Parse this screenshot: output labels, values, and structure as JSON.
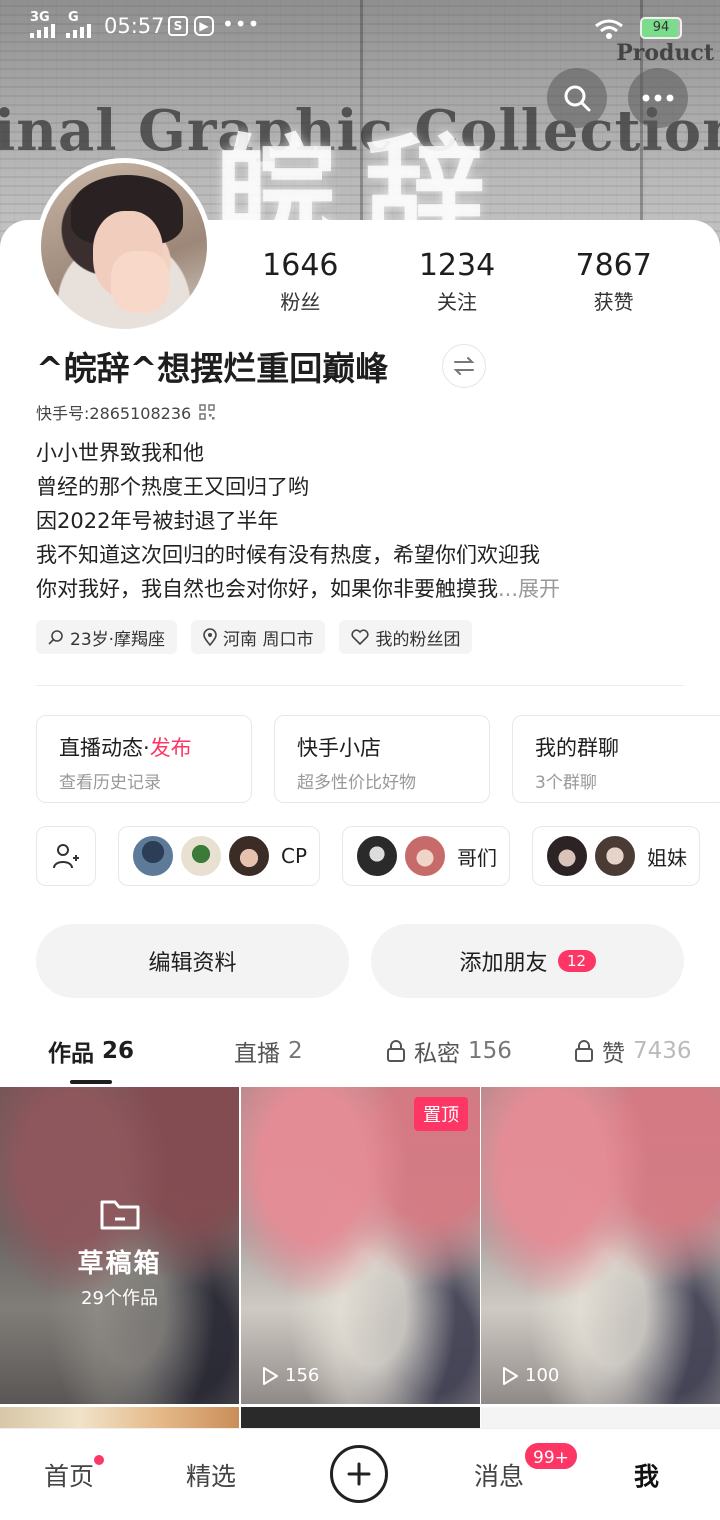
{
  "status_bar": {
    "network_1": "3G",
    "network_2": "G",
    "time": "05:57",
    "battery": "94",
    "battery_level": 0.94
  },
  "banner": {
    "headline": "inal Graphic Collection",
    "brand": "皖辞",
    "product": "Product"
  },
  "profile": {
    "stats": [
      {
        "value": "1646",
        "label": "粉丝"
      },
      {
        "value": "1234",
        "label": "关注"
      },
      {
        "value": "7867",
        "label": "获赞"
      }
    ],
    "nickname": "^皖辞^想摆烂重回巅峰",
    "kuaishou_id": "快手号:2865108236",
    "bio_lines": [
      "小小世界致我和他",
      "曾经的那个热度王又回归了哟",
      "因2022年号被封退了半年",
      "我不知道这次回归的时候有没有热度，希望你们欢迎我",
      "你对我好，我自然也会对你好，如果你非要触摸我"
    ],
    "bio_more": "...展开",
    "tags": [
      {
        "label": "23岁·摩羯座",
        "icon": "search-icon"
      },
      {
        "label": "河南 周口市",
        "icon": "location-icon"
      },
      {
        "label": "我的粉丝团",
        "icon": "heart-icon"
      }
    ]
  },
  "features": [
    {
      "title": "直播动态·",
      "accent": "发布",
      "subtitle": "查看历史记录"
    },
    {
      "title": "快手小店",
      "accent": "",
      "subtitle": "超多性价比好物"
    },
    {
      "title": "我的群聊",
      "accent": "",
      "subtitle": "3个群聊"
    }
  ],
  "groups": [
    {
      "label": "CP"
    },
    {
      "label": "哥们"
    },
    {
      "label": "姐妹"
    }
  ],
  "actions": {
    "edit_profile": "编辑资料",
    "add_friend": "添加朋友",
    "add_friend_badge": "12"
  },
  "tabs": [
    {
      "label": "作品",
      "count": "26",
      "locked": false,
      "active": true
    },
    {
      "label": "直播",
      "count": "2",
      "locked": false,
      "active": false
    },
    {
      "label": "私密",
      "count": "156",
      "locked": true,
      "active": false
    },
    {
      "label": "赞",
      "count": "7436",
      "locked": true,
      "active": false
    }
  ],
  "grid": {
    "draft_title": "草稿箱",
    "draft_count": "29个作品",
    "pinned_label": "置顶",
    "item2_plays": "156",
    "item3_plays": "100"
  },
  "bottom_nav": {
    "home": "首页",
    "featured": "精选",
    "messages": "消息",
    "messages_badge": "99+",
    "me": "我"
  },
  "colors": {
    "accent": "#fe3666"
  }
}
